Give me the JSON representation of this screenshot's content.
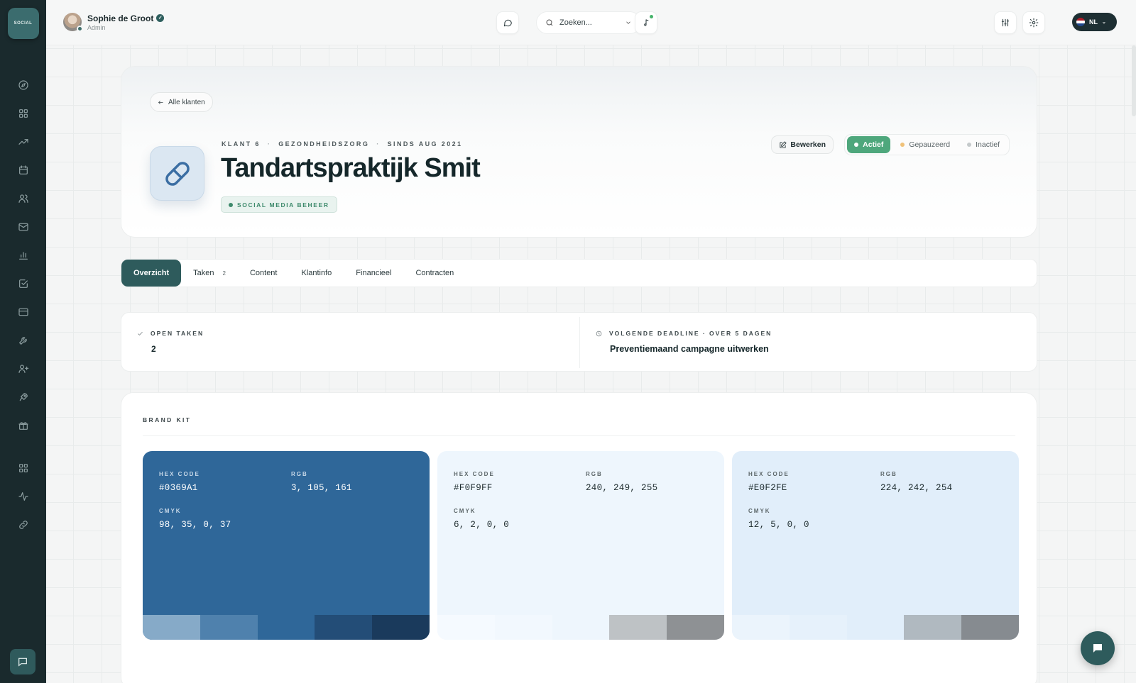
{
  "app": {
    "logo_text": "SOCIAL"
  },
  "sidebar": {
    "items": [
      {
        "icon": "compass-icon"
      },
      {
        "icon": "grid-icon"
      },
      {
        "icon": "trending-icon"
      },
      {
        "icon": "calendar-icon"
      },
      {
        "icon": "users-icon"
      },
      {
        "icon": "mail-icon"
      },
      {
        "icon": "bar-chart-icon"
      },
      {
        "icon": "check-square-icon"
      },
      {
        "icon": "credit-card-icon"
      },
      {
        "icon": "wrench-icon"
      },
      {
        "icon": "user-plus-icon"
      },
      {
        "icon": "rocket-icon"
      },
      {
        "icon": "gift-icon"
      },
      {
        "icon": "grid-icon"
      },
      {
        "icon": "activity-icon"
      },
      {
        "icon": "link-icon"
      }
    ]
  },
  "topbar": {
    "user_name": "Sophie de Groot",
    "user_role": "Admin",
    "search_placeholder": "Zoeken...",
    "language": "NL"
  },
  "header": {
    "back_label": "Alle klanten",
    "meta": [
      "KLANT 6",
      "GEZONDHEIDSZORG",
      "SINDS AUG 2021"
    ],
    "title": "Tandartspraktijk Smit",
    "service_badge": "SOCIAL MEDIA BEHEER",
    "edit_label": "Bewerken",
    "statuses": [
      {
        "label": "Actief",
        "active": true,
        "color": "#ffffff"
      },
      {
        "label": "Gepauzeerd",
        "active": false,
        "color": "#f0c27a"
      },
      {
        "label": "Inactief",
        "active": false,
        "color": "#c5cacb"
      }
    ]
  },
  "tabs": [
    {
      "label": "Overzicht",
      "active": true,
      "count": ""
    },
    {
      "label": "Taken",
      "active": false,
      "count": "2"
    },
    {
      "label": "Content",
      "active": false,
      "count": ""
    },
    {
      "label": "Klantinfo",
      "active": false,
      "count": ""
    },
    {
      "label": "Financieel",
      "active": false,
      "count": ""
    },
    {
      "label": "Contracten",
      "active": false,
      "count": ""
    }
  ],
  "stats": {
    "open_tasks_label": "OPEN TAKEN",
    "open_tasks_value": "2",
    "deadline_label": "VOLGENDE DEADLINE · OVER 5 DAGEN",
    "deadline_value": "Preventiemaand campagne uitwerken"
  },
  "brand_kit": {
    "title": "BRAND KIT",
    "labels": {
      "hex": "HEX CODE",
      "rgb": "RGB",
      "cmyk": "CMYK"
    },
    "colors": [
      {
        "hex": "#0369A1",
        "rgb": "3, 105, 161",
        "cmyk": "98, 35, 0, 37",
        "bg": "#2f6799",
        "text": "#ffffff",
        "label_color": "#c8d8e8",
        "tints": [
          "#86aac8",
          "#4f81ad",
          "#2f6799",
          "#234d77",
          "#1a3a5c"
        ]
      },
      {
        "hex": "#F0F9FF",
        "rgb": "240, 249, 255",
        "cmyk": "6, 2, 0, 0",
        "bg": "#eef6fd",
        "text": "#1d2b2e",
        "label_color": "#5c6669",
        "tints": [
          "#f5faff",
          "#f2f8fe",
          "#eef6fd",
          "#bec2c5",
          "#8e9194"
        ]
      },
      {
        "hex": "#E0F2FE",
        "rgb": "224, 242, 254",
        "cmyk": "12, 5, 0, 0",
        "bg": "#e1eefa",
        "text": "#1d2b2e",
        "label_color": "#5c6669",
        "tints": [
          "#ebf4fc",
          "#e6f1fb",
          "#e1eefa",
          "#b0b9c0",
          "#868b90"
        ]
      }
    ]
  }
}
